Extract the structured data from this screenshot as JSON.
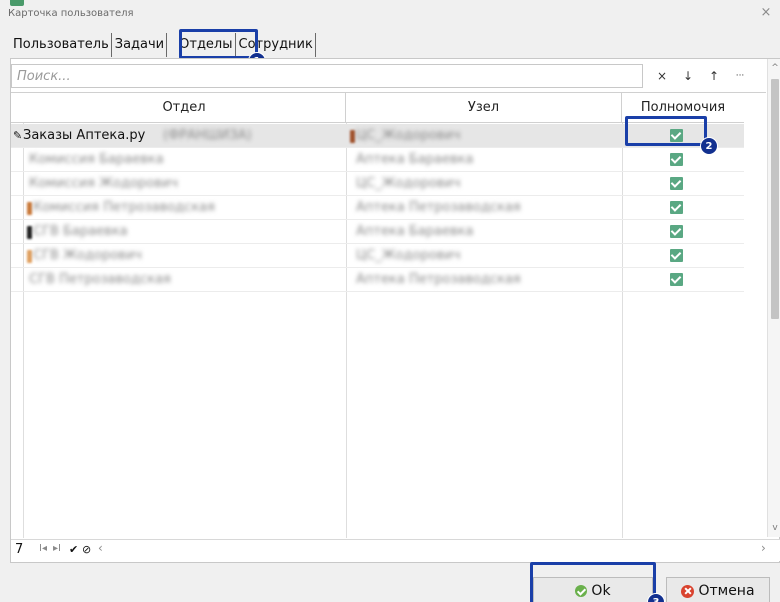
{
  "window": {
    "title": "Карточка пользователя",
    "close": "×"
  },
  "tabs": [
    {
      "label": "Пользователь"
    },
    {
      "label": "Задачи"
    },
    {
      "label": "Отделы"
    },
    {
      "label": "Сотрудник"
    }
  ],
  "annotations": [
    "1",
    "2",
    "3"
  ],
  "search": {
    "placeholder": "Поиск..."
  },
  "toolbar": {
    "clear": "×",
    "down": "↓",
    "up": "↑",
    "more": "···"
  },
  "grid": {
    "columns": [
      "Отдел",
      "Узел",
      "Полномочия"
    ],
    "rows": [
      {
        "edit_mark": "✎",
        "department": "Заказы Аптека.ру",
        "department_extra": "(ФРАНШИЗА)",
        "node": "ЦС_Жодорович",
        "checked": true,
        "accent": "#a0522d"
      },
      {
        "edit_mark": "",
        "department": "Комиссия Бараевка",
        "department_extra": "",
        "node": "Аптека Бараевка",
        "checked": true,
        "accent": ""
      },
      {
        "edit_mark": "",
        "department": "Комиссия Жодорович",
        "department_extra": "",
        "node": "ЦС_Жодорович",
        "checked": true,
        "accent": ""
      },
      {
        "edit_mark": "",
        "department": "Комиссия Петрозаводская",
        "department_extra": "",
        "node": "Аптека Петрозаводская",
        "checked": true,
        "accent": "#c9793a"
      },
      {
        "edit_mark": "",
        "department": "СГВ Бараевка",
        "department_extra": "",
        "node": "Аптека Бараевка",
        "checked": true,
        "accent": "#222222"
      },
      {
        "edit_mark": "",
        "department": "СГВ Жодорович",
        "department_extra": "",
        "node": "ЦС_Жодорович",
        "checked": true,
        "accent": "#e0a060"
      },
      {
        "edit_mark": "",
        "department": "СГВ Петрозаводская",
        "department_extra": "",
        "node": "Аптека Петрозаводская",
        "checked": true,
        "accent": ""
      }
    ]
  },
  "navigator": {
    "count": "7",
    "first": "I◂",
    "last": "▸I",
    "post": "✔",
    "cancel": "⊘",
    "prev": "‹",
    "right": "›"
  },
  "scroll": {
    "up": "^",
    "down": "v"
  },
  "buttons": {
    "ok": "Ok",
    "cancel": "Отмена"
  },
  "colors": {
    "highlight": "#1a3fa8",
    "checkbox": "#5aa883",
    "ok_icon": "#6ab04c",
    "cancel_icon": "#d9432f"
  }
}
